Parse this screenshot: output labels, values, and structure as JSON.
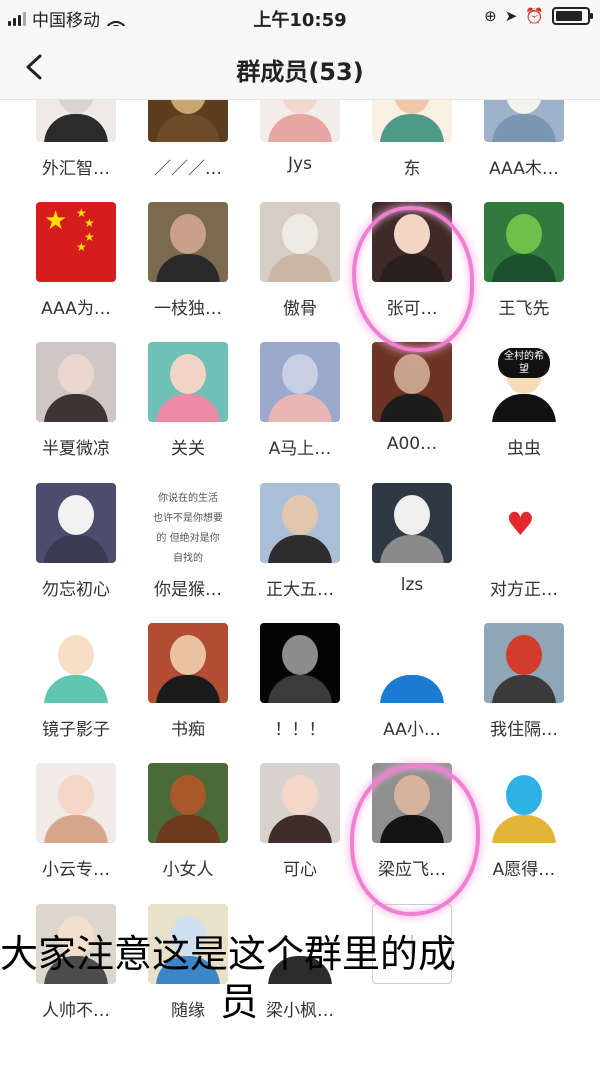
{
  "status_bar": {
    "carrier": "中国移动",
    "time": "上午10:59"
  },
  "nav": {
    "title": "群成员(53)"
  },
  "members": [
    {
      "name": "外汇智…",
      "c1": "#d9d4cf",
      "c2": "#2b2b2b",
      "bg": "#efeae6"
    },
    {
      "name": "／／／…",
      "c1": "#c9a56f",
      "c2": "#6c4a2a",
      "bg": "#5c3e1e"
    },
    {
      "name": "Jys",
      "c1": "#f3d6cc",
      "c2": "#e6a7a2",
      "bg": "#f4ece8"
    },
    {
      "name": "东",
      "c1": "#f1c7a9",
      "c2": "#4e9c88",
      "bg": "#fbf0e4"
    },
    {
      "name": "AAA木…",
      "c1": "#f1f1ee",
      "c2": "#7a96b3",
      "bg": "#9cb3c9"
    },
    {
      "name": "AAA为…",
      "c1": "#d61d1d",
      "c2": "#d61d1d",
      "bg": "#d61d1d",
      "flag": true
    },
    {
      "name": "一枝独…",
      "c1": "#c89f88",
      "c2": "#2a2a2a",
      "bg": "#7c6a50"
    },
    {
      "name": "傲骨",
      "c1": "#eeeae4",
      "c2": "#c9b6a4",
      "bg": "#d6cec4"
    },
    {
      "name": "张可…",
      "c1": "#f3d5c3",
      "c2": "#2a1f1c",
      "bg": "#3e2a27"
    },
    {
      "name": "王飞先",
      "c1": "#6fbf4a",
      "c2": "#1e4f2c",
      "bg": "#2f7a3c"
    },
    {
      "name": "半夏微凉",
      "c1": "#ead7cf",
      "c2": "#3d3533",
      "bg": "#cfc7c6"
    },
    {
      "name": "关关",
      "c1": "#f1d4c4",
      "c2": "#ee8aa6",
      "bg": "#6fc0b6"
    },
    {
      "name": "A马上…",
      "c1": "#c7cfe3",
      "c2": "#e9b6b4",
      "bg": "#9ba9cd"
    },
    {
      "name": "A00…",
      "c1": "#c9a28c",
      "c2": "#1c1c1c",
      "bg": "#6b3424"
    },
    {
      "name": "虫虫",
      "c1": "#f4dcb6",
      "c2": "#111111",
      "bg": "#ffffff"
    },
    {
      "name": "勿忘初心",
      "c1": "#f2f2f2",
      "c2": "#3a3a55",
      "bg": "#4b4d6c"
    },
    {
      "name": "你是猴…",
      "c1": "#ffffff",
      "c2": "#ffffff",
      "bg": "#ffffff",
      "text": true
    },
    {
      "name": "正大五…",
      "c1": "#e3c6ae",
      "c2": "#2d2d2d",
      "bg": "#a9c0d6"
    },
    {
      "name": "lzs",
      "c1": "#f0f0f0",
      "c2": "#8a8a8a",
      "bg": "#2f3944"
    },
    {
      "name": "对方正…",
      "c1": "#ffffff",
      "c2": "#ffffff",
      "bg": "#ffffff",
      "heart": true
    },
    {
      "name": "镜子影子",
      "c1": "#f6dfc6",
      "c2": "#60c6b2",
      "bg": "#ffffff"
    },
    {
      "name": "书痴",
      "c1": "#e9c2a2",
      "c2": "#1b1b1b",
      "bg": "#b24c32"
    },
    {
      "name": "！！！",
      "c1": "#8c8c8c",
      "c2": "#3b3b3b",
      "bg": "#050505"
    },
    {
      "name": "AA小…",
      "c1": "#ffffff",
      "c2": "#1a7bd1",
      "bg": "#ffffff"
    },
    {
      "name": "我住隔…",
      "c1": "#d33b2b",
      "c2": "#3a3a3a",
      "bg": "#8fa5b8"
    },
    {
      "name": "小云专…",
      "c1": "#f4d7c7",
      "c2": "#d7a68c",
      "bg": "#f0ebe6"
    },
    {
      "name": "小女人",
      "c1": "#a8582b",
      "c2": "#6d3a1c",
      "bg": "#4a6a3a"
    },
    {
      "name": "可心",
      "c1": "#f3d7c8",
      "c2": "#3d2f28",
      "bg": "#d7d2cc"
    },
    {
      "name": "梁应飞…",
      "c1": "#d8b39c",
      "c2": "#141414",
      "bg": "#8f8f8f"
    },
    {
      "name": "A愿得…",
      "c1": "#2eb2e6",
      "c2": "#e3b438",
      "bg": "#ffffff"
    },
    {
      "name": "人帅不…",
      "c1": "#f3e0cc",
      "c2": "#4c4c4c",
      "bg": "#dcd7cd"
    },
    {
      "name": "随缘",
      "c1": "#cfe0ee",
      "c2": "#3c85c8",
      "bg": "#e8e0c8"
    },
    {
      "name": "梁小枫…",
      "c1": "#ffffff",
      "c2": "#2b2b2b",
      "bg": "#ffffff"
    },
    {
      "name": "",
      "c1": "#ffffff",
      "c2": "#ffffff",
      "bg": "#ffffff",
      "plus": true
    }
  ],
  "overlay_caption": {
    "line1": "大家注意这是这个群里的成",
    "line2": "员"
  },
  "avatar_text": "你说在的生活 也许不是你想要的 但绝对是你自找的",
  "avatar_badge": "全村的希望",
  "accent": "#ef7fd0"
}
